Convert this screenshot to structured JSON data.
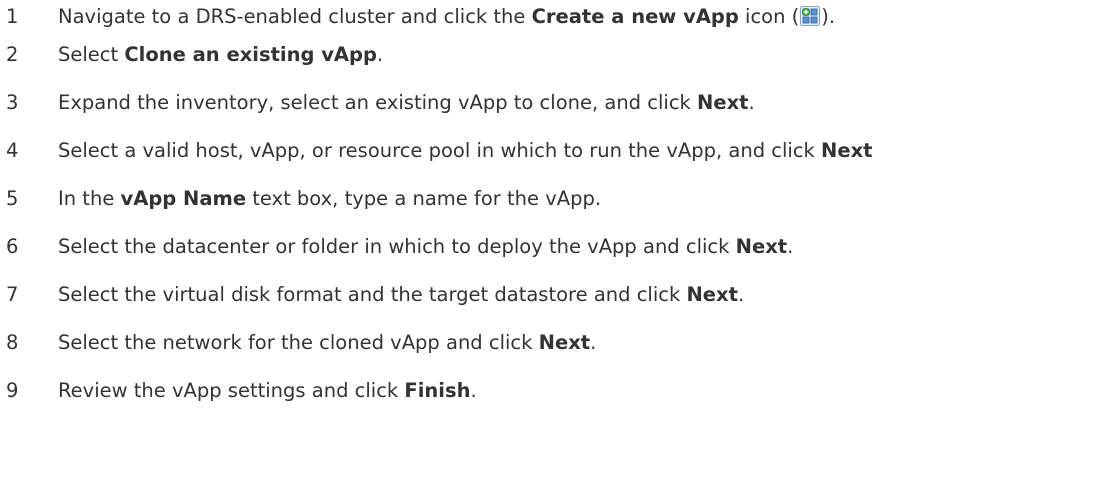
{
  "steps": [
    {
      "number": "1",
      "text_before": "Navigate to a DRS-enabled cluster and click the ",
      "bold": "Create a new vApp",
      "text_after": " icon (",
      "icon": "create-new-vapp-icon",
      "text_end": ")."
    },
    {
      "number": "2",
      "text_before": "Select ",
      "bold": "Clone an existing vApp",
      "text_after": "."
    },
    {
      "number": "3",
      "text_before": "Expand the inventory, select an existing vApp to clone, and click ",
      "bold": "Next",
      "text_after": "."
    },
    {
      "number": "4",
      "text_before": "Select a valid host, vApp, or resource pool in which to run the vApp, and click ",
      "bold": "Next",
      "text_after": ""
    },
    {
      "number": "5",
      "text_before": "In the ",
      "bold": "vApp Name",
      "text_after": " text box, type a name for the vApp."
    },
    {
      "number": "6",
      "text_before": "Select the datacenter or folder in which to deploy the vApp and click ",
      "bold": "Next",
      "text_after": "."
    },
    {
      "number": "7",
      "text_before": "Select the virtual disk format and the target datastore and click ",
      "bold": "Next",
      "text_after": "."
    },
    {
      "number": "8",
      "text_before": "Select the network for the cloned vApp and click ",
      "bold": "Next",
      "text_after": "."
    },
    {
      "number": "9",
      "text_before": "Review the vApp settings and click ",
      "bold": "Finish",
      "text_after": "."
    }
  ]
}
